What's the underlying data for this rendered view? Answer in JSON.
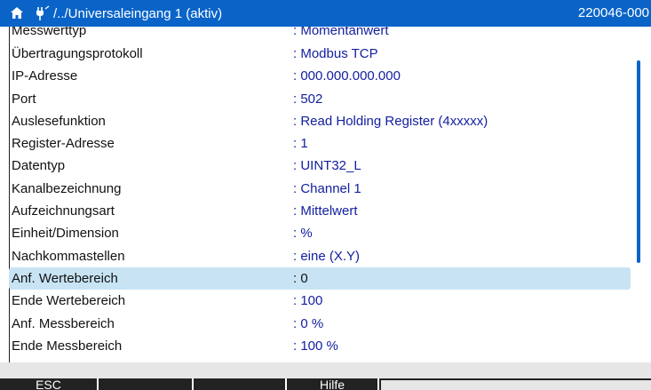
{
  "titlebar": {
    "path": "/../Universaleingang 1 (aktiv)",
    "device_id": "220046-000"
  },
  "rows": [
    {
      "label": "Messwerttyp",
      "value": ": Momentanwert"
    },
    {
      "label": "Übertragungsprotokoll",
      "value": ": Modbus TCP"
    },
    {
      "label": "IP-Adresse",
      "value": ": 000.000.000.000"
    },
    {
      "label": "Port",
      "value": ": 502"
    },
    {
      "label": "Auslesefunktion",
      "value": ": Read Holding Register (4xxxxx)"
    },
    {
      "label": "Register-Adresse",
      "value": ": 1"
    },
    {
      "label": "Datentyp",
      "value": ": UINT32_L"
    },
    {
      "label": "Kanalbezeichnung",
      "value": ": Channel 1"
    },
    {
      "label": "Aufzeichnungsart",
      "value": ": Mittelwert"
    },
    {
      "label": "Einheit/Dimension",
      "value": ": %"
    },
    {
      "label": "Nachkommastellen",
      "value": ": eine (X.Y)"
    },
    {
      "label": "Anf. Wertebereich",
      "value": ": 0"
    },
    {
      "label": "Ende Wertebereich",
      "value": ": 100"
    },
    {
      "label": "Anf. Messbereich",
      "value": ": 0 %"
    },
    {
      "label": "Ende Messbereich",
      "value": ": 100 %"
    }
  ],
  "softkeys": {
    "esc": "ESC",
    "key2": "",
    "key3": "",
    "help": "Hilfe"
  },
  "colors": {
    "titlebar": "#0a64c8",
    "selected_row": "#c8e4f4",
    "value_text": "#1420a0"
  }
}
